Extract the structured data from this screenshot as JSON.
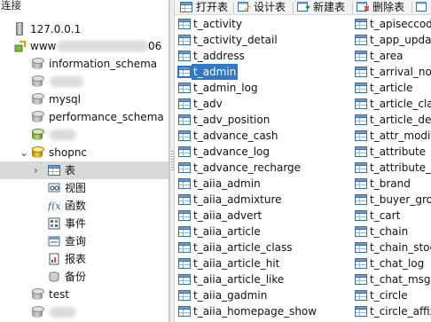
{
  "left_header": "连接",
  "tree": {
    "connection": "127.0.0.1",
    "server": "www",
    "server_suffix": "06",
    "databases": [
      {
        "name": "information_schema"
      },
      {
        "name": ""
      },
      {
        "name": "mysql"
      },
      {
        "name": "performance_schema"
      },
      {
        "name": ""
      },
      {
        "name": "shopnc"
      }
    ],
    "shopnc_children": [
      "表",
      "视图",
      "函数",
      "事件",
      "查询",
      "报表",
      "备份"
    ],
    "after": [
      {
        "name": "test"
      },
      {
        "name": ""
      }
    ]
  },
  "toolbar": {
    "open_table": "打开表",
    "design_table": "设计表",
    "new_table": "新建表",
    "delete_table": "删除表",
    "more": "导"
  },
  "tables_col1": [
    "t_activity",
    "t_activity_detail",
    "t_address",
    "t_admin",
    "t_admin_log",
    "t_adv",
    "t_adv_position",
    "t_advance_cash",
    "t_advance_log",
    "t_advance_recharge",
    "t_aiia_admin",
    "t_aiia_admixture",
    "t_aiia_advert",
    "t_aiia_article",
    "t_aiia_article_class",
    "t_aiia_article_hit",
    "t_aiia_article_like",
    "t_aiia_gadmin",
    "t_aiia_homepage_show"
  ],
  "tables_col2": [
    "t_apiseccode",
    "t_app_updat",
    "t_area",
    "t_arrival_not",
    "t_article",
    "t_article_clas",
    "t_article_det",
    "t_attr_modif",
    "t_attribute",
    "t_attribute_v",
    "t_brand",
    "t_buyer_gro",
    "t_cart",
    "t_chain",
    "t_chain_stoc",
    "t_chat_log",
    "t_chat_msg",
    "t_circle",
    "t_circle_affix"
  ],
  "selected_table": "t_admin"
}
